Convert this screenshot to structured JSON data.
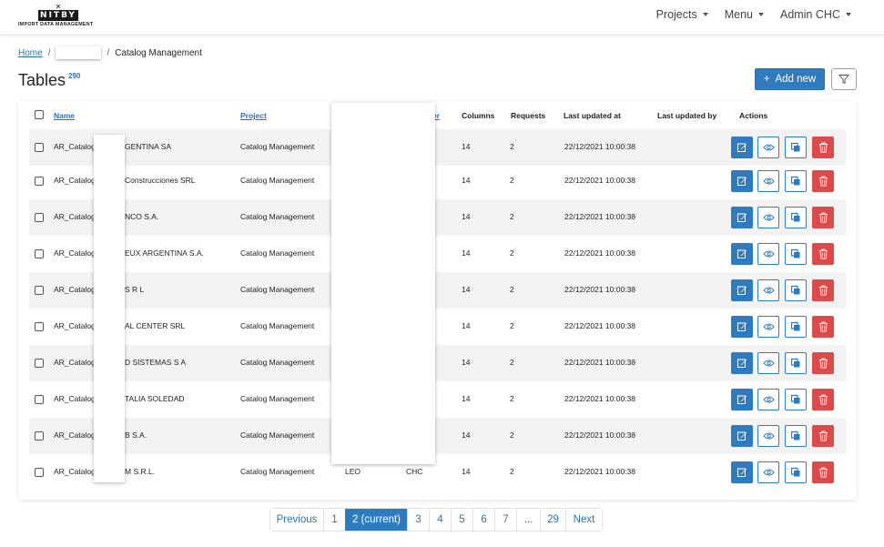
{
  "app": {
    "logo_text": "NITBY",
    "logo_subtitle": "IMPORT DATA MANAGEMENT"
  },
  "nav": {
    "projects": "Projects",
    "menu": "Menu",
    "user": "Admin CHC"
  },
  "breadcrumb": {
    "home": "Home",
    "current": "Catalog Management"
  },
  "page": {
    "title": "Tables",
    "count": "290",
    "add_label": "Add new"
  },
  "table": {
    "headers": {
      "name": "Name",
      "project": "Project",
      "owner_fragment": "er",
      "columns": "Columns",
      "requests": "Requests",
      "last_updated_at": "Last updated at",
      "last_updated_by": "Last updated by",
      "actions": "Actions"
    },
    "rows": [
      {
        "name_start": "AR_Catalog",
        "name_end": "GENTINA SA",
        "project": "Catalog Management",
        "c1": "",
        "c2": "",
        "columns": "14",
        "requests": "2",
        "updated_at": "22/12/2021 10:00:38",
        "updated_by": ""
      },
      {
        "name_start": "AR_Catalog",
        "name_end": "Construcciones SRL",
        "project": "Catalog Management",
        "c1": "",
        "c2": "",
        "columns": "14",
        "requests": "2",
        "updated_at": "22/12/2021 10:00:38",
        "updated_by": ""
      },
      {
        "name_start": "AR_Catalog",
        "name_end": "NCO S.A.",
        "project": "Catalog Management",
        "c1": "",
        "c2": "",
        "columns": "14",
        "requests": "2",
        "updated_at": "22/12/2021 10:00:38",
        "updated_by": ""
      },
      {
        "name_start": "AR_Catalog",
        "name_end": "EUX ARGENTINA S.A.",
        "project": "Catalog Management",
        "c1": "",
        "c2": "",
        "columns": "14",
        "requests": "2",
        "updated_at": "22/12/2021 10:00:38",
        "updated_by": ""
      },
      {
        "name_start": "AR_Catalog",
        "name_end": "S R L",
        "project": "Catalog Management",
        "c1": "",
        "c2": "",
        "columns": "14",
        "requests": "2",
        "updated_at": "22/12/2021 10:00:38",
        "updated_by": ""
      },
      {
        "name_start": "AR_Catalog",
        "name_end": "AL CENTER SRL",
        "project": "Catalog Management",
        "c1": "",
        "c2": "",
        "columns": "14",
        "requests": "2",
        "updated_at": "22/12/2021 10:00:38",
        "updated_by": ""
      },
      {
        "name_start": "AR_Catalog",
        "name_end": "D SISTEMAS S A",
        "project": "Catalog Management",
        "c1": "",
        "c2": "",
        "columns": "14",
        "requests": "2",
        "updated_at": "22/12/2021 10:00:38",
        "updated_by": ""
      },
      {
        "name_start": "AR_Catalog",
        "name_end": "TALIA SOLEDAD",
        "project": "Catalog Management",
        "c1": "",
        "c2": "",
        "columns": "14",
        "requests": "2",
        "updated_at": "22/12/2021 10:00:38",
        "updated_by": ""
      },
      {
        "name_start": "AR_Catalog",
        "name_end": "B S.A.",
        "project": "Catalog Management",
        "c1": "",
        "c2": "",
        "columns": "14",
        "requests": "2",
        "updated_at": "22/12/2021 10:00:38",
        "updated_by": ""
      },
      {
        "name_start": "AR_Catalog",
        "name_end": "M S.R.L.",
        "project": "Catalog Management",
        "c1": "LEO",
        "c2": "CHC",
        "columns": "14",
        "requests": "2",
        "updated_at": "22/12/2021 10:00:38",
        "updated_by": ""
      }
    ]
  },
  "pagination": {
    "items": [
      "Previous",
      "1",
      "2 (current)",
      "3",
      "4",
      "5",
      "6",
      "7",
      "...",
      "29",
      "Next"
    ],
    "active_index": 2
  },
  "colors": {
    "primary": "#2f7bc0",
    "danger": "#dc4b4b",
    "stripe": "#f2f2f2"
  },
  "icons": {
    "edit": "edit-icon",
    "view": "eye-icon",
    "copy": "copy-icon",
    "delete": "trash-icon",
    "filter": "filter-icon",
    "add": "plus-icon"
  }
}
